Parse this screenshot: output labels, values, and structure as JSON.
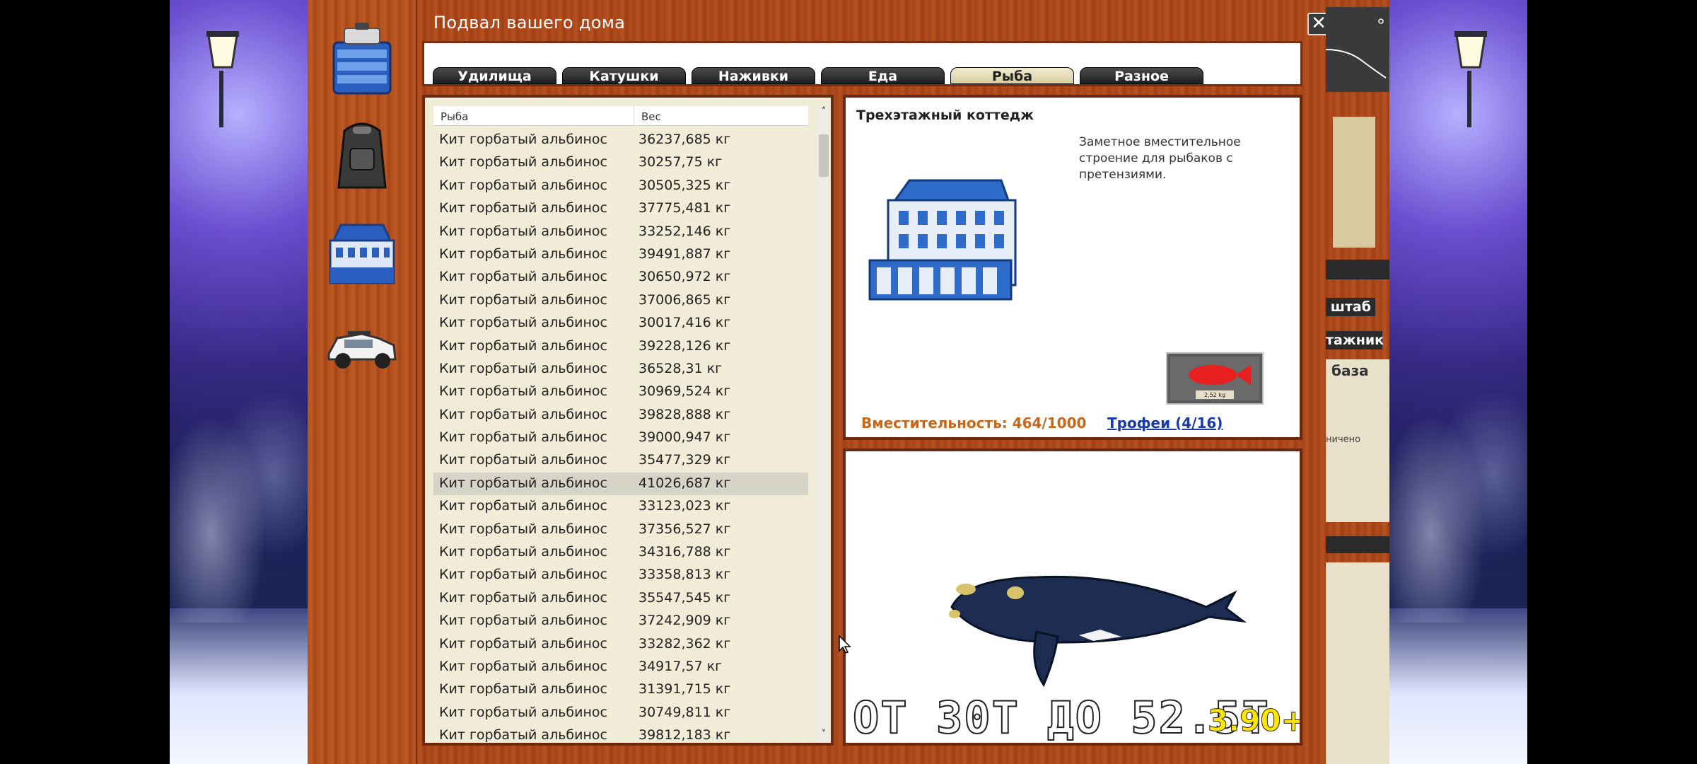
{
  "window": {
    "title": "Подвал вашего дома",
    "close_symbol": "✕"
  },
  "sidebar": {
    "items": [
      {
        "name": "tackle-box-icon"
      },
      {
        "name": "backpack-icon"
      },
      {
        "name": "house-icon"
      },
      {
        "name": "car-icon"
      }
    ]
  },
  "tabs": [
    {
      "label": "Удилища",
      "active": false
    },
    {
      "label": "Катушки",
      "active": false
    },
    {
      "label": "Наживки",
      "active": false
    },
    {
      "label": "Еда",
      "active": false
    },
    {
      "label": "Рыба",
      "active": true
    },
    {
      "label": "Разное",
      "active": false
    }
  ],
  "list": {
    "headers": {
      "name": "Рыба",
      "weight": "Вес"
    },
    "scroll_up": "˄",
    "scroll_down": "˅",
    "selected_index": 15,
    "rows": [
      {
        "name": "Кит горбатый альбинос",
        "weight": "36237,685 кг"
      },
      {
        "name": "Кит горбатый альбинос",
        "weight": "30257,75 кг"
      },
      {
        "name": "Кит горбатый альбинос",
        "weight": "30505,325 кг"
      },
      {
        "name": "Кит горбатый альбинос",
        "weight": "37775,481 кг"
      },
      {
        "name": "Кит горбатый альбинос",
        "weight": "33252,146 кг"
      },
      {
        "name": "Кит горбатый альбинос",
        "weight": "39491,887 кг"
      },
      {
        "name": "Кит горбатый альбинос",
        "weight": "30650,972 кг"
      },
      {
        "name": "Кит горбатый альбинос",
        "weight": "37006,865 кг"
      },
      {
        "name": "Кит горбатый альбинос",
        "weight": "30017,416 кг"
      },
      {
        "name": "Кит горбатый альбинос",
        "weight": "39228,126 кг"
      },
      {
        "name": "Кит горбатый альбинос",
        "weight": "36528,31 кг"
      },
      {
        "name": "Кит горбатый альбинос",
        "weight": "30969,524 кг"
      },
      {
        "name": "Кит горбатый альбинос",
        "weight": "39828,888 кг"
      },
      {
        "name": "Кит горбатый альбинос",
        "weight": "39000,947 кг"
      },
      {
        "name": "Кит горбатый альбинос",
        "weight": "35477,329 кг"
      },
      {
        "name": "Кит горбатый альбинос",
        "weight": "41026,687 кг"
      },
      {
        "name": "Кит горбатый альбинос",
        "weight": "33123,023 кг"
      },
      {
        "name": "Кит горбатый альбинос",
        "weight": "37356,527 кг"
      },
      {
        "name": "Кит горбатый альбинос",
        "weight": "34316,788 кг"
      },
      {
        "name": "Кит горбатый альбинос",
        "weight": "33358,813 кг"
      },
      {
        "name": "Кит горбатый альбинос",
        "weight": "35547,545 кг"
      },
      {
        "name": "Кит горбатый альбинос",
        "weight": "37242,909 кг"
      },
      {
        "name": "Кит горбатый альбинос",
        "weight": "33282,362 кг"
      },
      {
        "name": "Кит горбатый альбинос",
        "weight": "34917,57 кг"
      },
      {
        "name": "Кит горбатый альбинос",
        "weight": "31391,715 кг"
      },
      {
        "name": "Кит горбатый альбинос",
        "weight": "30749,811 кг"
      },
      {
        "name": "Кит горбатый альбинос",
        "weight": "39812,183 кг"
      }
    ]
  },
  "info": {
    "title": "Трехэтажный коттедж",
    "description": "Заметное вместительное строение для рыбаков с претензиями.",
    "capacity": "Вместительность: 464/1000",
    "trophies_link": "Трофеи (4/16)",
    "trophy_plate_text": "2,52 kg"
  },
  "preview": {
    "range_text": "ОТ  30Т ДО 52.5Т",
    "version_text": "3.90+"
  },
  "right_peek": {
    "scale_label": "штаб",
    "tag_label": "тажник",
    "base_label": "база",
    "note_label": "ничено"
  },
  "colors": {
    "wood": "#a9461a",
    "capacity_orange": "#c8671a",
    "link_blue": "#1a3aa8",
    "version_yellow": "#ffe600",
    "list_bg": "#f1ecd7"
  }
}
